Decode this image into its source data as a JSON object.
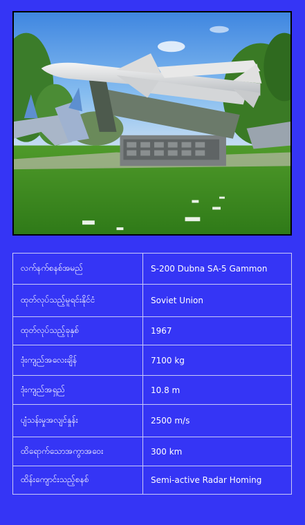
{
  "photo": {
    "subject": "S-200 missile on launcher in outdoor museum"
  },
  "specs": {
    "rows": [
      {
        "label": "လက်နက်စနစ်အမည်",
        "value": "S-200 Dubna SA-5 Gammon"
      },
      {
        "label": "ထုတ်လုပ်သည့်မူရင်းနိုင်ငံ",
        "value": "Soviet Union"
      },
      {
        "label": "ထုတ်လုပ်သည့်ခုနှစ်",
        "value": "1967"
      },
      {
        "label": "ဒုံးကျည်အလေးချိန်",
        "value": "7100 kg"
      },
      {
        "label": "ဒုံးကျည်အရှည်",
        "value": "10.8 m"
      },
      {
        "label": "ပျံသန်းမှုအလျင်နှုန်း",
        "value": "2500 m/s"
      },
      {
        "label": "ထိရောက်သောအကွာအဝေး",
        "value": "300 km"
      },
      {
        "label": "ထိန်းကျောင်းသည့်စနစ်",
        "value": "Semi-active Radar Homing"
      }
    ]
  },
  "colors": {
    "background": "#3535f5",
    "table_border": "#c9c9f7",
    "text": "#ffffff"
  }
}
